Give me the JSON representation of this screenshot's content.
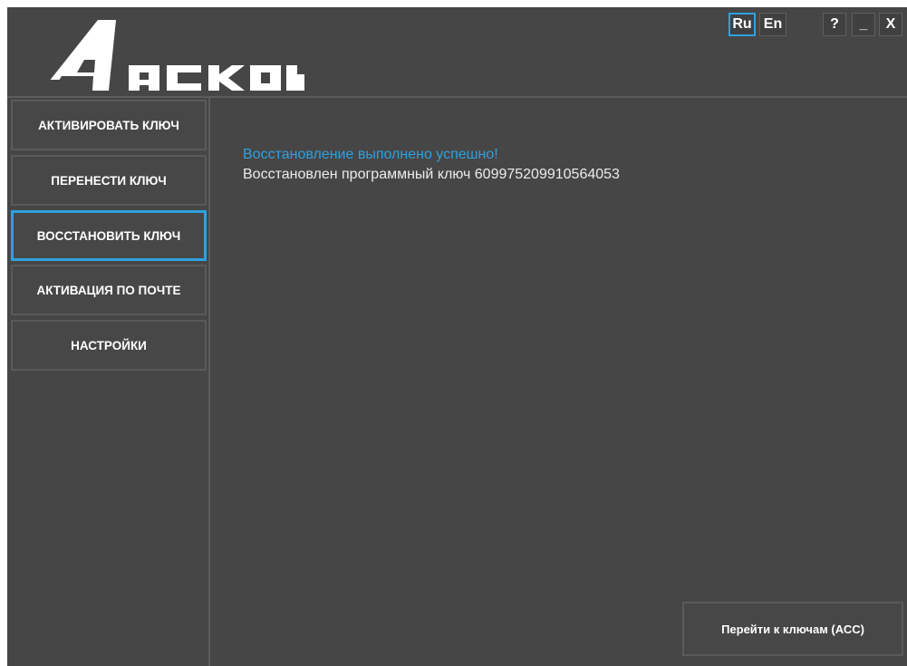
{
  "header": {
    "logo_text": "АСКОН",
    "lang_buttons": [
      "Ru",
      "En"
    ],
    "active_lang": "Ru",
    "help_label": "?",
    "minimize_label": "_",
    "close_label": "X"
  },
  "sidebar": {
    "items": [
      {
        "label": "АКТИВИРОВАТЬ КЛЮЧ"
      },
      {
        "label": "ПЕРЕНЕСТИ КЛЮЧ"
      },
      {
        "label": "ВОССТАНОВИТЬ КЛЮЧ"
      },
      {
        "label": "АКТИВАЦИЯ ПО ПОЧТЕ"
      },
      {
        "label": "НАСТРОЙКИ"
      }
    ],
    "active_index": 2
  },
  "main": {
    "success_message": "Восстановление выполнено успешно!",
    "detail_prefix": "Восстановлен программный ключ",
    "key_number": "609975209910564053"
  },
  "footer": {
    "go_to_keys_label": "Перейти к ключам (АСС)"
  },
  "colors": {
    "background": "#464646",
    "accent": "#2ea1df",
    "border": "#5a5a5a",
    "text": "#ffffff"
  }
}
